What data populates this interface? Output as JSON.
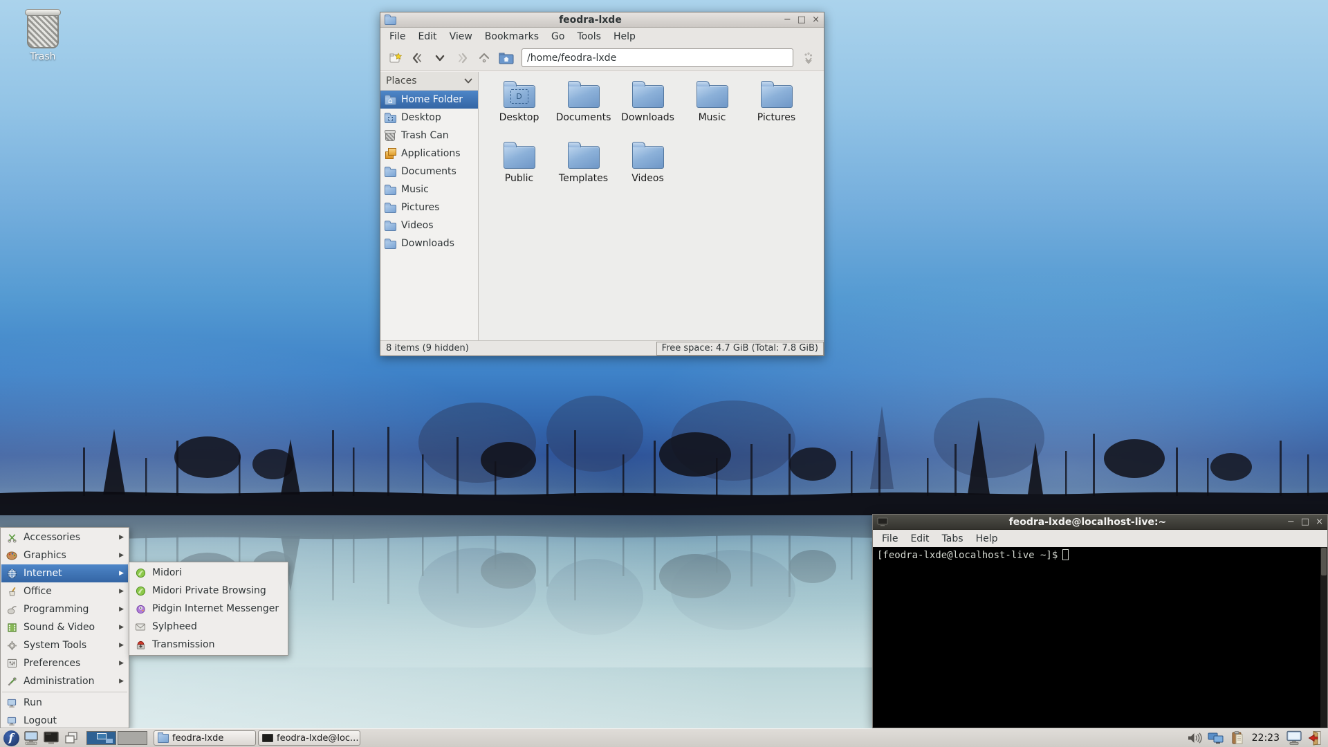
{
  "desktop": {
    "trash_label": "Trash"
  },
  "colors": {
    "selection_blue": "#3465a4",
    "menu_highlight": "#4e86c8",
    "terminal_bg": "#000000",
    "terminal_fg": "#d3d7cf",
    "taskbar_bg": "#d8d5d1",
    "wallpaper_sky": "#76afdd"
  },
  "file_manager": {
    "title": "feodra-lxde",
    "window_controls": {
      "minimize": "−",
      "maximize": "□",
      "close": "×"
    },
    "menu": {
      "file": "File",
      "edit": "Edit",
      "view": "View",
      "bookmarks": "Bookmarks",
      "go": "Go",
      "tools": "Tools",
      "help": "Help"
    },
    "path": "/home/feodra-lxde",
    "places_header": "Places",
    "places": [
      {
        "label": "Home Folder"
      },
      {
        "label": "Desktop"
      },
      {
        "label": "Trash Can"
      },
      {
        "label": "Applications"
      },
      {
        "label": "Documents"
      },
      {
        "label": "Music"
      },
      {
        "label": "Pictures"
      },
      {
        "label": "Videos"
      },
      {
        "label": "Downloads"
      }
    ],
    "folders": [
      {
        "label": "Desktop"
      },
      {
        "label": "Documents"
      },
      {
        "label": "Downloads"
      },
      {
        "label": "Music"
      },
      {
        "label": "Pictures"
      },
      {
        "label": "Public"
      },
      {
        "label": "Templates"
      },
      {
        "label": "Videos"
      }
    ],
    "status_left": "8 items (9 hidden)",
    "status_right": "Free space: 4.7 GiB (Total: 7.8 GiB)"
  },
  "terminal": {
    "title": "feodra-lxde@localhost-live:~",
    "window_controls": {
      "minimize": "−",
      "maximize": "□",
      "close": "×"
    },
    "menu": {
      "file": "File",
      "edit": "Edit",
      "tabs": "Tabs",
      "help": "Help"
    },
    "prompt": "[feodra-lxde@localhost-live ~]$"
  },
  "app_menu": {
    "arrow": "▶",
    "items": [
      {
        "label": "Accessories"
      },
      {
        "label": "Graphics"
      },
      {
        "label": "Internet"
      },
      {
        "label": "Office"
      },
      {
        "label": "Programming"
      },
      {
        "label": "Sound & Video"
      },
      {
        "label": "System Tools"
      },
      {
        "label": "Preferences"
      },
      {
        "label": "Administration"
      },
      {
        "label": "Run"
      },
      {
        "label": "Logout"
      }
    ],
    "submenu_items": [
      {
        "label": "Midori"
      },
      {
        "label": "Midori Private Browsing"
      },
      {
        "label": "Pidgin Internet Messenger"
      },
      {
        "label": "Sylpheed"
      },
      {
        "label": "Transmission"
      }
    ]
  },
  "taskbar": {
    "tasks": [
      {
        "label": "feodra-lxde"
      },
      {
        "label": "feodra-lxde@loc..."
      }
    ],
    "clock": "22:23"
  }
}
